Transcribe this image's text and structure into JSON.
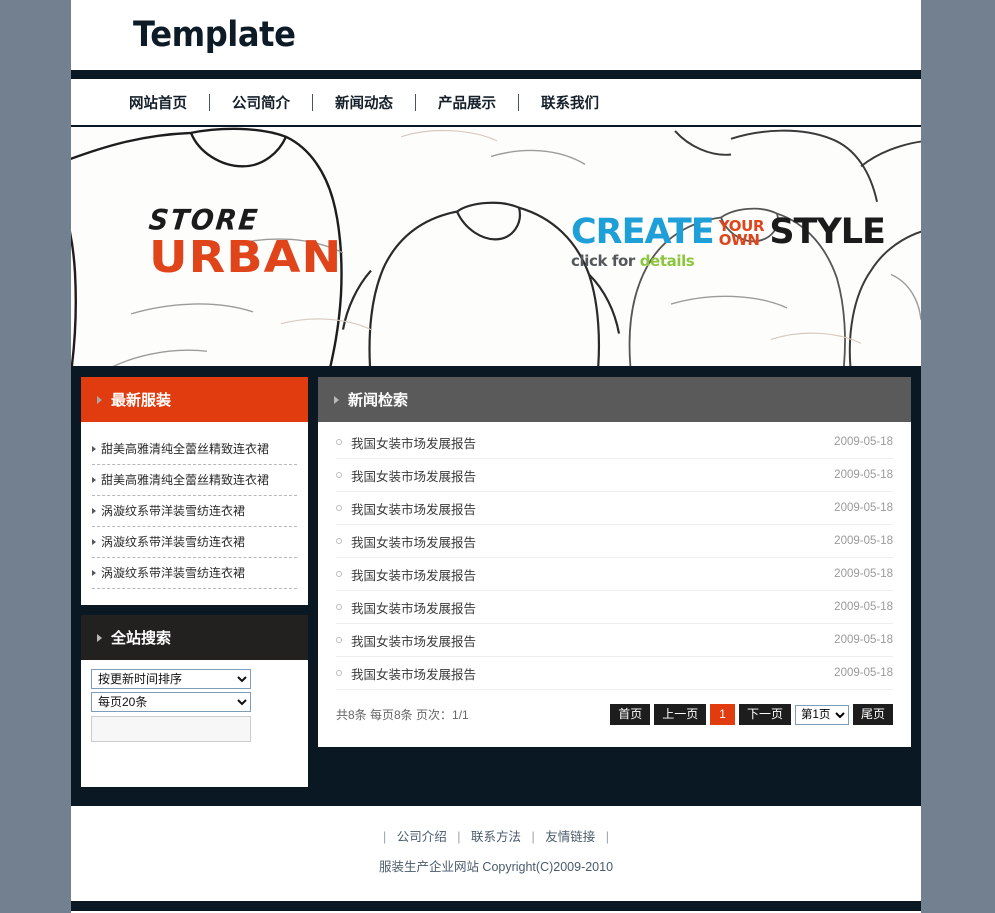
{
  "site": {
    "logo_text": "Template"
  },
  "nav": {
    "items": [
      {
        "label": "网站首页"
      },
      {
        "label": "公司简介"
      },
      {
        "label": "新闻动态"
      },
      {
        "label": "产品展示"
      },
      {
        "label": "联系我们"
      }
    ]
  },
  "banner": {
    "left": {
      "line1": "STORE",
      "line2": "URBAN"
    },
    "right": {
      "create": "CREATE",
      "your": "YOUR",
      "own": "OWN",
      "style": "STYLE",
      "click": "click for ",
      "details": "details"
    },
    "colors": {
      "urban_orange": "#e0441a",
      "create_blue": "#1e9fd8",
      "details_green": "#8cc63e"
    }
  },
  "sidebar": {
    "latest": {
      "title": "最新服装",
      "items": [
        {
          "label": "甜美高雅清纯全蕾丝精致连衣裙"
        },
        {
          "label": "甜美高雅清纯全蕾丝精致连衣裙"
        },
        {
          "label": "涡漩纹系带洋装雪纺连衣裙"
        },
        {
          "label": "涡漩纹系带洋装雪纺连衣裙"
        },
        {
          "label": "涡漩纹系带洋装雪纺连衣裙"
        }
      ]
    },
    "search": {
      "title": "全站搜索",
      "sort_selected": "按更新时间排序",
      "sort_options": [
        "按更新时间排序"
      ],
      "perpage_selected": "每页20条",
      "perpage_options": [
        "每页20条"
      ],
      "keyword_value": "",
      "keyword_placeholder": ""
    }
  },
  "news": {
    "title": "新闻检索",
    "items": [
      {
        "title": "我国女装市场发展报告",
        "date": "2009-05-18"
      },
      {
        "title": "我国女装市场发展报告",
        "date": "2009-05-18"
      },
      {
        "title": "我国女装市场发展报告",
        "date": "2009-05-18"
      },
      {
        "title": "我国女装市场发展报告",
        "date": "2009-05-18"
      },
      {
        "title": "我国女装市场发展报告",
        "date": "2009-05-18"
      },
      {
        "title": "我国女装市场发展报告",
        "date": "2009-05-18"
      },
      {
        "title": "我国女装市场发展报告",
        "date": "2009-05-18"
      },
      {
        "title": "我国女装市场发展报告",
        "date": "2009-05-18"
      }
    ],
    "pager": {
      "info": "共8条 每页8条 页次：1/1",
      "first": "首页",
      "prev": "上一页",
      "current": "1",
      "next": "下一页",
      "jump_selected": "第1页",
      "jump_options": [
        "第1页"
      ],
      "last": "尾页"
    }
  },
  "footer": {
    "links": [
      {
        "label": "公司介绍"
      },
      {
        "label": "联系方法"
      },
      {
        "label": "友情链接"
      }
    ],
    "separator": "|",
    "copyright": "服装生产企业网站  Copyright(C)2009-2010"
  }
}
